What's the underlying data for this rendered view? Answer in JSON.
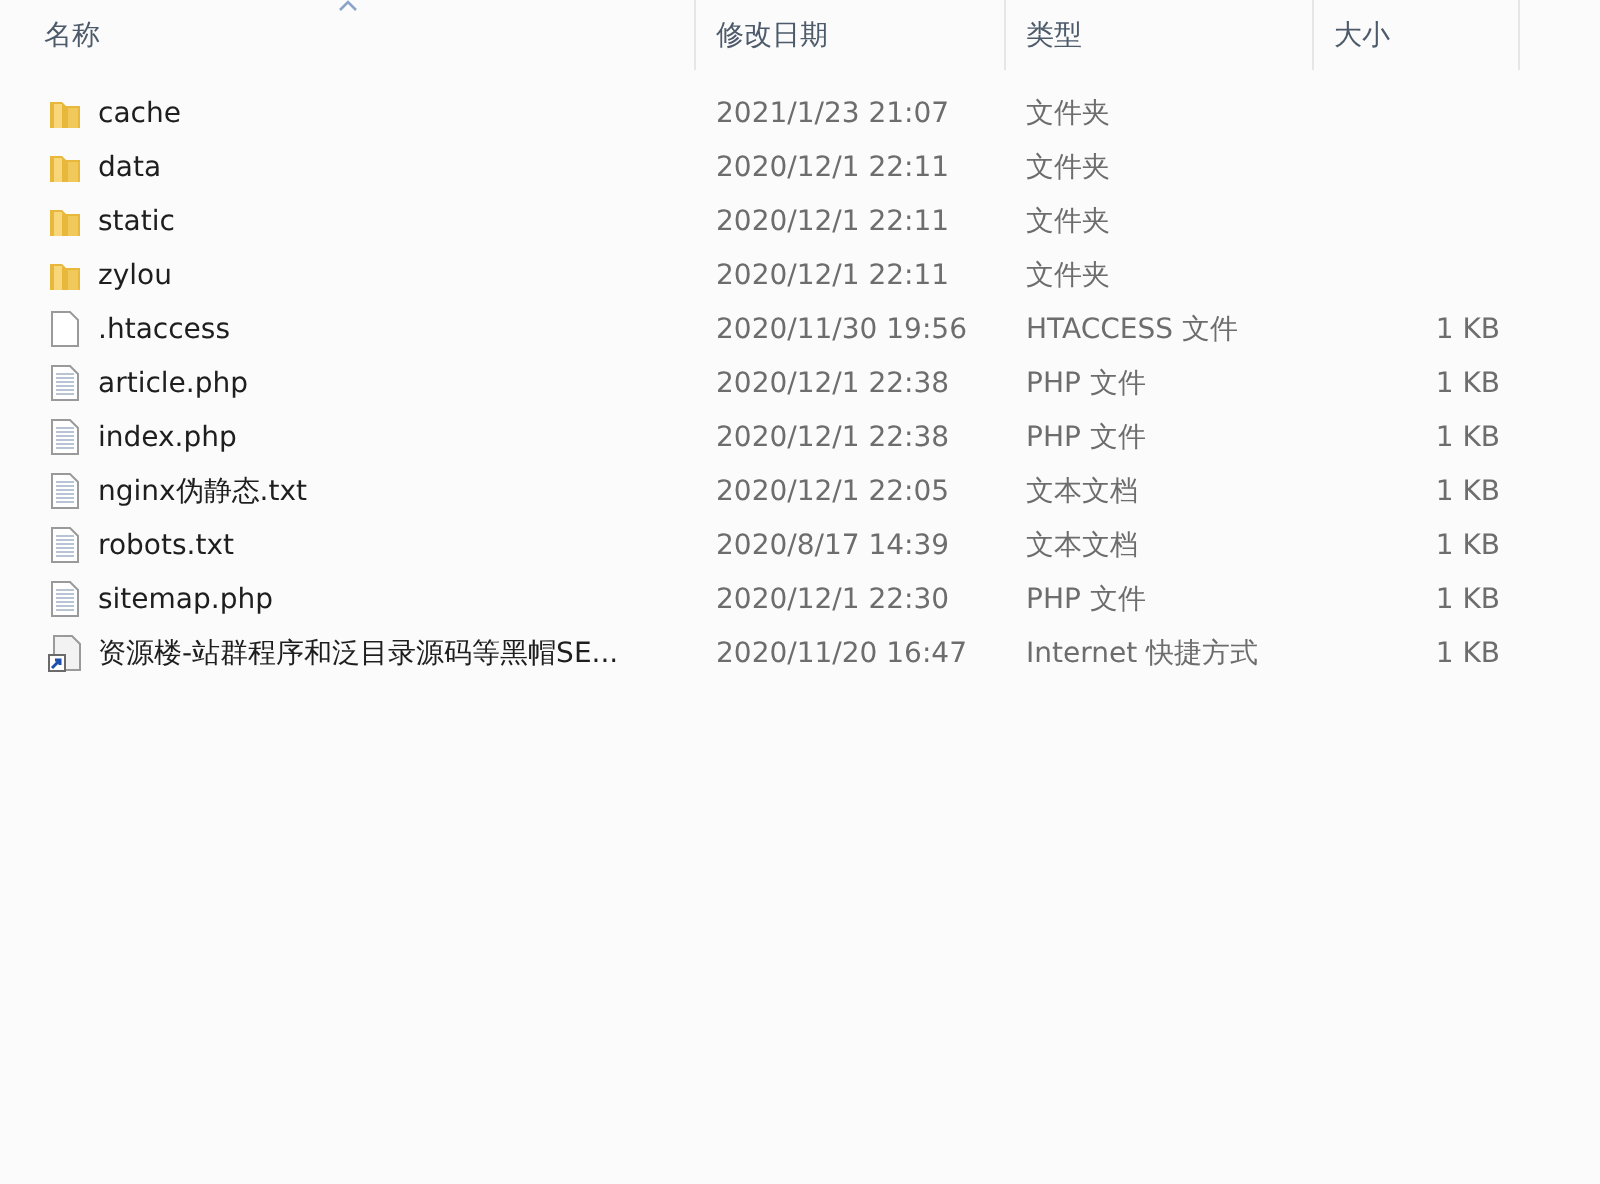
{
  "columns": [
    {
      "label": "名称",
      "sorted": true
    },
    {
      "label": "修改日期",
      "sorted": false
    },
    {
      "label": "类型",
      "sorted": false
    },
    {
      "label": "大小",
      "sorted": false
    }
  ],
  "rows": [
    {
      "kind": "folder",
      "name": "cache",
      "date": "2021/1/23 21:07",
      "type": "文件夹"
    },
    {
      "kind": "folder",
      "name": "data",
      "date": "2020/12/1 22:11",
      "type": "文件夹"
    },
    {
      "kind": "folder",
      "name": "static",
      "date": "2020/12/1 22:11",
      "type": "文件夹"
    },
    {
      "kind": "folder",
      "name": "zylou",
      "date": "2020/12/1 22:11",
      "type": "文件夹"
    },
    {
      "kind": "blank",
      "name": ".htaccess",
      "date": "2020/11/30 19:56",
      "type": "HTACCESS 文件",
      "size": "1 KB"
    },
    {
      "kind": "text",
      "name": "article.php",
      "date": "2020/12/1 22:38",
      "type": "PHP 文件",
      "size": "1 KB"
    },
    {
      "kind": "text",
      "name": "index.php",
      "date": "2020/12/1 22:38",
      "type": "PHP 文件",
      "size": "1 KB"
    },
    {
      "kind": "text",
      "name": "nginx伪静态.txt",
      "date": "2020/12/1 22:05",
      "type": "文本文档",
      "size": "1 KB"
    },
    {
      "kind": "text",
      "name": "robots.txt",
      "date": "2020/8/17 14:39",
      "type": "文本文档",
      "size": "1 KB"
    },
    {
      "kind": "text",
      "name": "sitemap.php",
      "date": "2020/12/1 22:30",
      "type": "PHP 文件",
      "size": "1 KB"
    },
    {
      "kind": "shortcut",
      "name": "资源楼-站群程序和泛目录源码等黑帽SE...",
      "date": "2020/11/20 16:47",
      "type": "Internet 快捷方式",
      "size": "1 KB"
    }
  ]
}
